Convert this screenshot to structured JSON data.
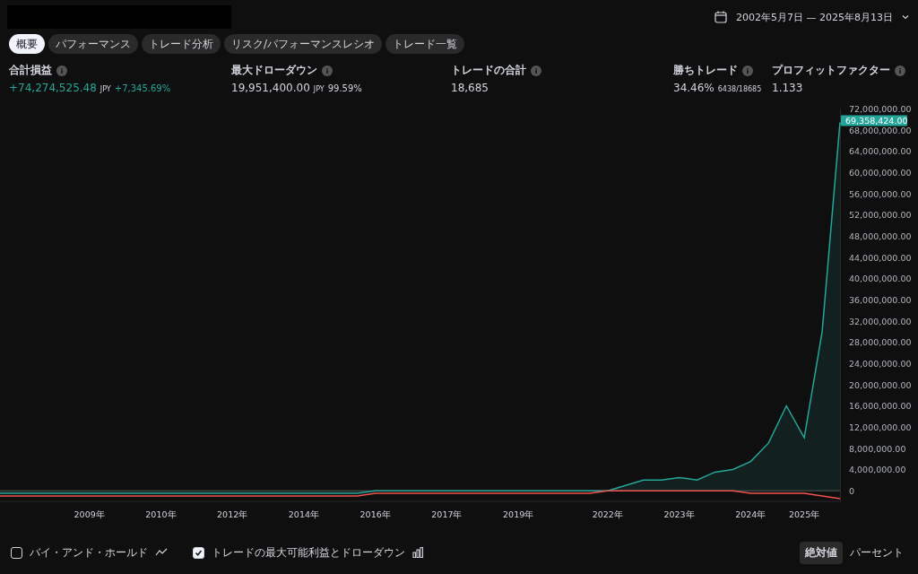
{
  "header": {
    "date_range": "2002年5月7日 — 2025年8月13日"
  },
  "tabs": [
    {
      "label": "概要",
      "selected": true
    },
    {
      "label": "パフォーマンス",
      "selected": false
    },
    {
      "label": "トレード分析",
      "selected": false
    },
    {
      "label": "リスク/パフォーマンスレシオ",
      "selected": false
    },
    {
      "label": "トレード一覧",
      "selected": false
    }
  ],
  "stats": [
    {
      "label": "合計損益",
      "value": "+74,274,525.48",
      "positive": true,
      "unit": "JPY",
      "extra": "+7,345.69%"
    },
    {
      "label": "最大ドローダウン",
      "value": "19,951,400.00",
      "positive": false,
      "unit": "JPY",
      "extra": "99.59%"
    },
    {
      "label": "トレードの合計",
      "value": "18,685",
      "positive": false
    },
    {
      "label": "勝ちトレード",
      "value": "34.46%",
      "positive": false,
      "extra": "6438/18685"
    },
    {
      "label": "プロフィットファクター",
      "value": "1.133",
      "positive": false
    }
  ],
  "chart": {
    "chart_data": {
      "type": "line",
      "categories": [
        null,
        null,
        null,
        null,
        null,
        "2009年",
        null,
        null,
        null,
        "2010年",
        null,
        null,
        null,
        "2012年",
        null,
        null,
        null,
        "2014年",
        null,
        null,
        null,
        "2016年",
        null,
        null,
        null,
        "2017年",
        null,
        null,
        null,
        "2019年",
        null,
        null,
        null,
        null,
        "2022年",
        null,
        null,
        null,
        "2023年",
        null,
        null,
        null,
        "2024年",
        null,
        null,
        "2025年",
        null,
        null
      ],
      "ylim": [
        -2000000,
        72000000
      ],
      "yticks": [
        {
          "value": 0,
          "label": "0"
        },
        {
          "value": 4000000,
          "label": "4,000,000.00"
        },
        {
          "value": 8000000,
          "label": "8,000,000.00"
        },
        {
          "value": 12000000,
          "label": "12,000,000.00"
        },
        {
          "value": 16000000,
          "label": "16,000,000.00"
        },
        {
          "value": 20000000,
          "label": "20,000,000.00"
        },
        {
          "value": 24000000,
          "label": "24,000,000.00"
        },
        {
          "value": 28000000,
          "label": "28,000,000.00"
        },
        {
          "value": 32000000,
          "label": "32,000,000.00"
        },
        {
          "value": 36000000,
          "label": "36,000,000.00"
        },
        {
          "value": 40000000,
          "label": "40,000,000.00"
        },
        {
          "value": 44000000,
          "label": "44,000,000.00"
        },
        {
          "value": 48000000,
          "label": "48,000,000.00"
        },
        {
          "value": 52000000,
          "label": "52,000,000.00"
        },
        {
          "value": 56000000,
          "label": "56,000,000.00"
        },
        {
          "value": 60000000,
          "label": "60,000,000.00"
        },
        {
          "value": 64000000,
          "label": "64,000,000.00"
        },
        {
          "value": 68000000,
          "label": "68,000,000.00"
        },
        {
          "value": 72000000,
          "label": "72,000,000.00"
        }
      ],
      "series": [
        {
          "color": "#26a69a",
          "values": [
            -500000,
            -500000,
            -500000,
            -500000,
            -500000,
            -500000,
            -500000,
            -500000,
            -500000,
            -500000,
            -500000,
            -500000,
            -500000,
            -500000,
            -500000,
            -500000,
            -500000,
            -500000,
            -500000,
            -500000,
            -500000,
            0,
            0,
            0,
            0,
            0,
            0,
            0,
            0,
            0,
            0,
            0,
            0,
            0,
            0,
            1000000,
            2000000,
            2000000,
            2500000,
            2000000,
            3500000,
            4000000,
            5500000,
            9000000,
            16000000,
            10000000,
            30000000,
            69400000
          ]
        },
        {
          "color": "#ef5350",
          "values": [
            -1000000,
            -1000000,
            -1000000,
            -1000000,
            -1000000,
            -1000000,
            -1000000,
            -1000000,
            -1000000,
            -1000000,
            -1000000,
            -1000000,
            -1000000,
            -1000000,
            -1000000,
            -1000000,
            -1000000,
            -1000000,
            -1000000,
            -1000000,
            -1000000,
            -500000,
            -500000,
            -500000,
            -500000,
            -500000,
            -500000,
            -500000,
            -500000,
            -500000,
            -500000,
            -500000,
            -500000,
            -500000,
            0,
            0,
            0,
            0,
            0,
            0,
            0,
            0,
            -500000,
            -500000,
            -500000,
            -500000,
            -1000000,
            -1500000
          ]
        }
      ]
    },
    "last_value": "69,358,424.00"
  },
  "footer": {
    "options": [
      {
        "label": "バイ・アンド・ホールド",
        "checked": false,
        "kind": "line"
      },
      {
        "label": "トレードの最大可能利益とドローダウン",
        "checked": true,
        "kind": "bars"
      }
    ],
    "modes": [
      {
        "label": "絶対値",
        "selected": true
      },
      {
        "label": "パーセント",
        "selected": false
      }
    ]
  }
}
